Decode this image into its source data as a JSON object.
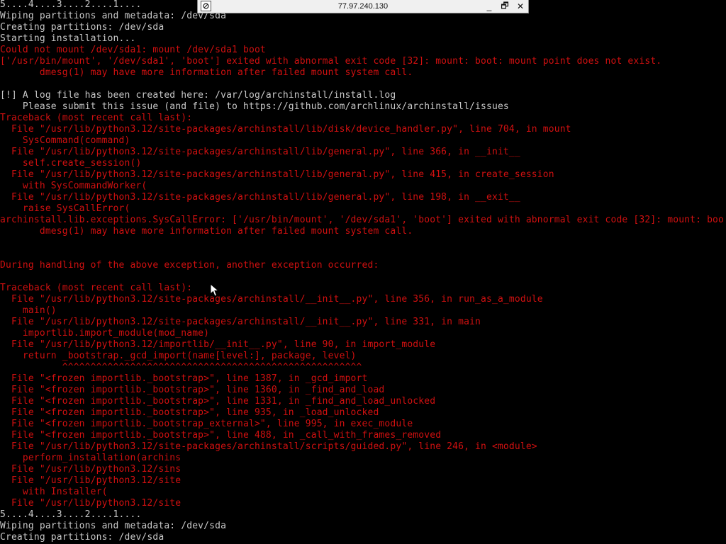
{
  "remote_bar": {
    "host": "77.97.240.130",
    "pin_icon": "pin-icon",
    "minimize_glyph": "_",
    "restore_glyph": "🗗",
    "close_glyph": "✕"
  },
  "colors": {
    "background": "#000000",
    "normal_text": "#c8c8c8",
    "error_text": "#d01010"
  },
  "console": {
    "lines": [
      {
        "color": "white",
        "text": "5....4....3....2....1...."
      },
      {
        "color": "white",
        "text": "Wiping partitions and metadata: /dev/sda"
      },
      {
        "color": "white",
        "text": "Creating partitions: /dev/sda"
      },
      {
        "color": "white",
        "text": "Starting installation..."
      },
      {
        "color": "red",
        "text": "Could not mount /dev/sda1: mount /dev/sda1 boot"
      },
      {
        "color": "red",
        "text": "['/usr/bin/mount', '/dev/sda1', 'boot'] exited with abnormal exit code [32]: mount: boot: mount point does not exist."
      },
      {
        "color": "red",
        "text": "       dmesg(1) may have more information after failed mount system call."
      },
      {
        "color": "white",
        "text": ""
      },
      {
        "color": "white",
        "text": "[!] A log file has been created here: /var/log/archinstall/install.log"
      },
      {
        "color": "white",
        "text": "    Please submit this issue (and file) to https://github.com/archlinux/archinstall/issues"
      },
      {
        "color": "red",
        "text": "Traceback (most recent call last):"
      },
      {
        "color": "red",
        "text": "  File \"/usr/lib/python3.12/site-packages/archinstall/lib/disk/device_handler.py\", line 704, in mount"
      },
      {
        "color": "red",
        "text": "    SysCommand(command)"
      },
      {
        "color": "red",
        "text": "  File \"/usr/lib/python3.12/site-packages/archinstall/lib/general.py\", line 366, in __init__"
      },
      {
        "color": "red",
        "text": "    self.create_session()"
      },
      {
        "color": "red",
        "text": "  File \"/usr/lib/python3.12/site-packages/archinstall/lib/general.py\", line 415, in create_session"
      },
      {
        "color": "red",
        "text": "    with SysCommandWorker("
      },
      {
        "color": "red",
        "text": "  File \"/usr/lib/python3.12/site-packages/archinstall/lib/general.py\", line 198, in __exit__"
      },
      {
        "color": "red",
        "text": "    raise SysCallError("
      },
      {
        "color": "red",
        "text": "archinstall.lib.exceptions.SysCallError: ['/usr/bin/mount', '/dev/sda1', 'boot'] exited with abnormal exit code [32]: mount: boo"
      },
      {
        "color": "red",
        "text": "       dmesg(1) may have more information after failed mount system call."
      },
      {
        "color": "white",
        "text": ""
      },
      {
        "color": "white",
        "text": ""
      },
      {
        "color": "red",
        "text": "During handling of the above exception, another exception occurred:"
      },
      {
        "color": "white",
        "text": ""
      },
      {
        "color": "red",
        "text": "Traceback (most recent call last):"
      },
      {
        "color": "red",
        "text": "  File \"/usr/lib/python3.12/site-packages/archinstall/__init__.py\", line 356, in run_as_a_module"
      },
      {
        "color": "red",
        "text": "    main()"
      },
      {
        "color": "red",
        "text": "  File \"/usr/lib/python3.12/site-packages/archinstall/__init__.py\", line 331, in main"
      },
      {
        "color": "red",
        "text": "    importlib.import_module(mod_name)"
      },
      {
        "color": "red",
        "text": "  File \"/usr/lib/python3.12/importlib/__init__.py\", line 90, in import_module"
      },
      {
        "color": "red",
        "text": "    return _bootstrap._gcd_import(name[level:], package, level)"
      },
      {
        "color": "red",
        "text": "           ^^^^^^^^^^^^^^^^^^^^^^^^^^^^^^^^^^^^^^^^^^^^^^^^^^^^^"
      },
      {
        "color": "red",
        "text": "  File \"<frozen importlib._bootstrap>\", line 1387, in _gcd_import"
      },
      {
        "color": "red",
        "text": "  File \"<frozen importlib._bootstrap>\", line 1360, in _find_and_load"
      },
      {
        "color": "red",
        "text": "  File \"<frozen importlib._bootstrap>\", line 1331, in _find_and_load_unlocked"
      },
      {
        "color": "red",
        "text": "  File \"<frozen importlib._bootstrap>\", line 935, in _load_unlocked"
      },
      {
        "color": "red",
        "text": "  File \"<frozen importlib._bootstrap_external>\", line 995, in exec_module"
      },
      {
        "color": "red",
        "text": "  File \"<frozen importlib._bootstrap>\", line 488, in _call_with_frames_removed"
      },
      {
        "color": "red",
        "text": "  File \"/usr/lib/python3.12/site-packages/archinstall/scripts/guided.py\", line 246, in <module>"
      },
      {
        "color": "red",
        "text": "    perform_installation(archins"
      },
      {
        "color": "red",
        "text": "  File \"/usr/lib/python3.12/sins"
      },
      {
        "color": "red",
        "text": "  File \"/usr/lib/python3.12/site"
      },
      {
        "color": "red",
        "text": "    with Installer("
      },
      {
        "color": "red",
        "text": "  File \"/usr/lib/python3.12/site"
      },
      {
        "color": "white",
        "text": "5....4....3....2....1...."
      },
      {
        "color": "white",
        "text": "Wiping partitions and metadata: /dev/sda"
      },
      {
        "color": "white",
        "text": "Creating partitions: /dev/sda"
      }
    ]
  }
}
